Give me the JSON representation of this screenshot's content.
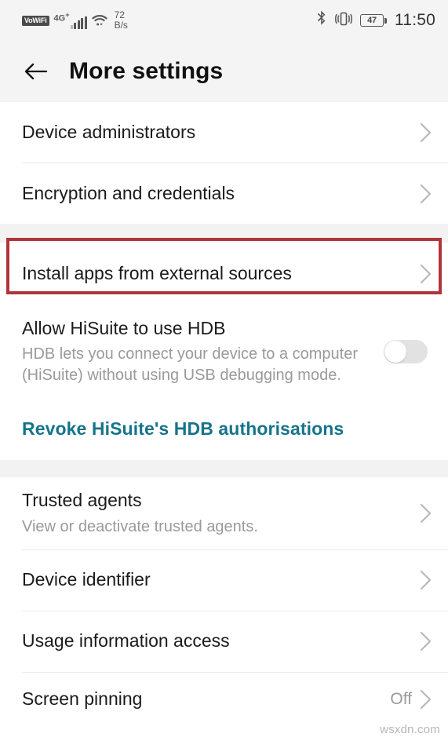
{
  "statusbar": {
    "vowifi_label": "VoWiFi",
    "network_label": "4G",
    "network_sup": "+",
    "data_speed_value": "72",
    "data_speed_unit": "B/s",
    "battery_level": "47",
    "time": "11:50",
    "icons": [
      "vowifi-badge",
      "signal-bars-icon",
      "wifi-icon",
      "data-speed-indicator",
      "bluetooth-icon",
      "vibrate-icon",
      "battery-icon"
    ]
  },
  "appbar": {
    "back_icon": "back-arrow-icon",
    "title": "More settings"
  },
  "sections": [
    {
      "rows": [
        {
          "title": "Device administrators",
          "sub": "",
          "value": "",
          "chevron": true
        },
        {
          "title": "Encryption and credentials",
          "sub": "",
          "value": "",
          "chevron": true
        }
      ]
    },
    {
      "rows": [
        {
          "title": "Install apps from external sources",
          "sub": "",
          "value": "",
          "chevron": true,
          "highlighted": true
        },
        {
          "title": "Allow HiSuite to use HDB",
          "sub": "HDB lets you connect your device to a computer (HiSuite) without using USB debugging mode.",
          "toggle": "off"
        },
        {
          "title": "Revoke HiSuite's HDB authorisations",
          "link": true
        }
      ]
    },
    {
      "rows": [
        {
          "title": "Trusted agents",
          "sub": "View or deactivate trusted agents.",
          "value": "",
          "chevron": true
        },
        {
          "title": "Device identifier",
          "sub": "",
          "value": "",
          "chevron": true
        },
        {
          "title": "Usage information access",
          "sub": "",
          "value": "",
          "chevron": true
        },
        {
          "title": "Screen pinning",
          "sub": "",
          "value": "Off",
          "chevron": true
        }
      ]
    }
  ],
  "colors": {
    "highlight_red": "#b0353a",
    "link_teal": "#16748a",
    "bar_bg": "#f4f4f4",
    "gap_bg": "#f2f2f2"
  },
  "watermark": "wsxdn.com"
}
